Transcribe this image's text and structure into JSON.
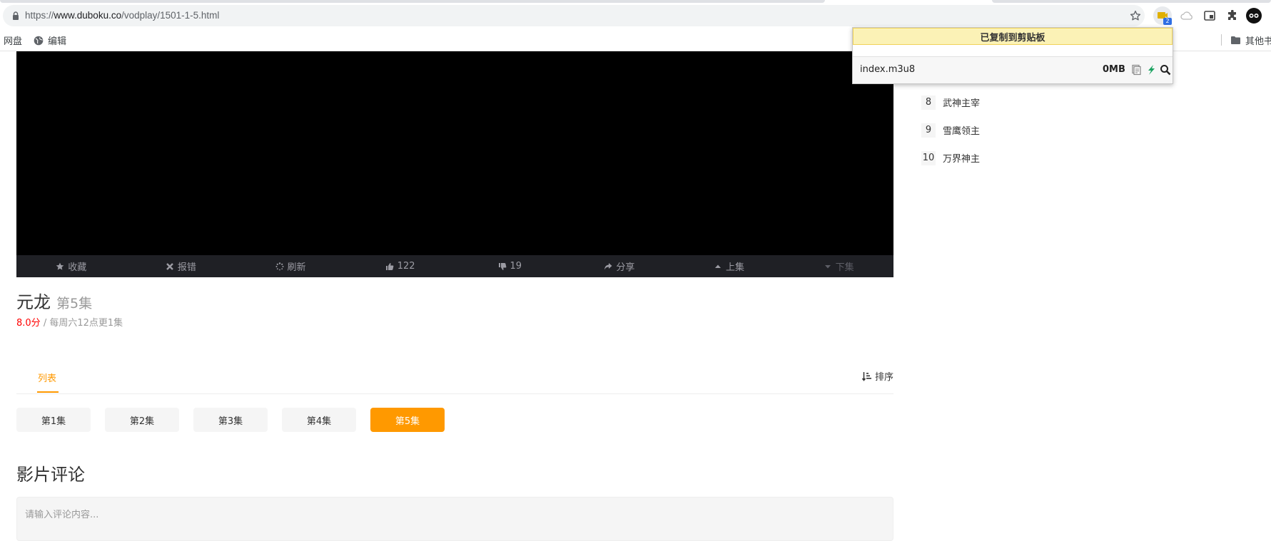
{
  "browser": {
    "url_prefix": "https://",
    "url_host": "www.duboku.co",
    "url_path": "/vodplay/1501-1-5.html",
    "extension_badge": "2",
    "bookmarks": [
      {
        "label": "网盘"
      },
      {
        "label": "编辑"
      },
      {
        "label": "其他书签"
      }
    ]
  },
  "player": {
    "controls": [
      {
        "label": "收藏",
        "icon": "star-icon"
      },
      {
        "label": "报错",
        "icon": "close-icon"
      },
      {
        "label": "刷新",
        "icon": "spinner-icon"
      },
      {
        "label": "122",
        "icon": "thumbs-up-icon"
      },
      {
        "label": "19",
        "icon": "thumbs-down-icon"
      },
      {
        "label": "分享",
        "icon": "share-icon"
      },
      {
        "label": "上集",
        "icon": "caret-up-icon"
      },
      {
        "label": "下集",
        "icon": "caret-down-icon"
      }
    ]
  },
  "show": {
    "title": "元龙",
    "episode": "第5集",
    "score": "8.0分",
    "schedule": " / 每周六12点更1集"
  },
  "tabs": {
    "list_label": "列表",
    "sort_label": "排序"
  },
  "episodes": [
    "第1集",
    "第2集",
    "第3集",
    "第4集",
    "第5集"
  ],
  "active_episode_index": 4,
  "comments": {
    "title": "影片评论",
    "placeholder": "请输入评论内容..."
  },
  "ranking": [
    {
      "num": "8",
      "title": "武神主宰"
    },
    {
      "num": "9",
      "title": "雪鹰领主"
    },
    {
      "num": "10",
      "title": "万界神主"
    }
  ],
  "popup": {
    "toast": "已复制到剪贴板",
    "file_name": "index.m3u8",
    "file_size": "0MB"
  },
  "colors": {
    "accent": "#ff9900",
    "score": "#ff0000",
    "toast_bg": "#fbf2b6"
  }
}
